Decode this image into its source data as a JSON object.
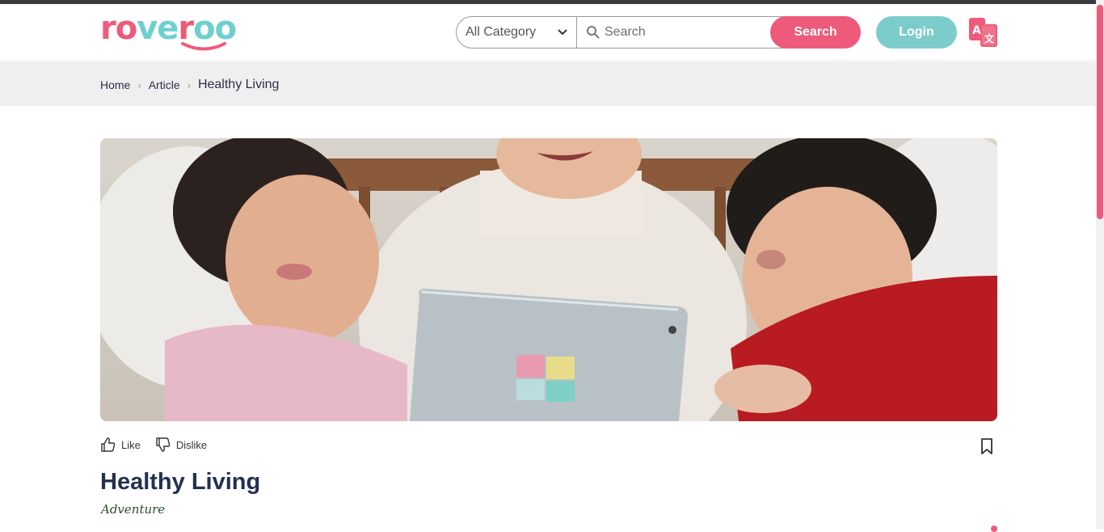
{
  "brand": {
    "logo_part1": "ro",
    "logo_part2": "ve",
    "logo_part3": "r",
    "logo_part4": "oo",
    "primary_color": "#ee5a7a",
    "secondary_color": "#7ccccc"
  },
  "header": {
    "category_select": {
      "selected": "All Category"
    },
    "search": {
      "placeholder": "Search",
      "button_label": "Search"
    },
    "login_label": "Login",
    "language_icon": "translate-icon"
  },
  "breadcrumb": {
    "items": [
      "Home",
      "Article"
    ],
    "current": "Healthy Living"
  },
  "article": {
    "image_alt": "Children and mother looking at a tablet",
    "like_label": "Like",
    "dislike_label": "Dislike",
    "title": "Healthy Living",
    "category": "Adventure"
  }
}
